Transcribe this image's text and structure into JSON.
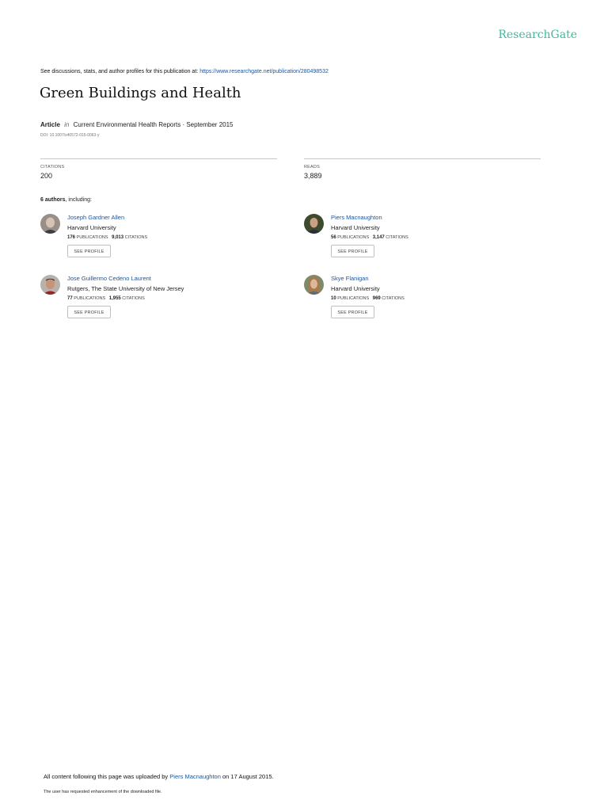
{
  "brand": "ResearchGate",
  "discussion": {
    "prefix": "See discussions, stats, and author profiles for this publication at:",
    "url": "https://www.researchgate.net/publication/280498532"
  },
  "title": "Green Buildings and Health",
  "meta": {
    "type": "Article",
    "in": "in",
    "journal": "Current Environmental Health Reports · September 2015"
  },
  "doi": "DOI: 10.1007/s40572-015-0063-y",
  "stats": {
    "citations": {
      "label": "CITATIONS",
      "value": "200"
    },
    "reads": {
      "label": "READS",
      "value": "3,889"
    }
  },
  "authors_heading": {
    "count": "6 authors",
    "suffix": ", including:"
  },
  "authors": [
    {
      "name": "Joseph Gardner Allen",
      "institution": "Harvard University",
      "publications": "176",
      "publications_label": "PUBLICATIONS",
      "citations": "9,013",
      "citations_label": "CITATIONS",
      "button": "SEE PROFILE"
    },
    {
      "name": "Piers Macnaughton",
      "institution": "Harvard University",
      "publications": "56",
      "publications_label": "PUBLICATIONS",
      "citations": "3,147",
      "citations_label": "CITATIONS",
      "button": "SEE PROFILE"
    },
    {
      "name": "Jose Guillermo Cedeno Laurent",
      "institution": "Rutgers, The State University of New Jersey",
      "publications": "77",
      "publications_label": "PUBLICATIONS",
      "citations": "1,955",
      "citations_label": "CITATIONS",
      "button": "SEE PROFILE"
    },
    {
      "name": "Skye Flanigan",
      "institution": "Harvard University",
      "publications": "10",
      "publications_label": "PUBLICATIONS",
      "citations": "969",
      "citations_label": "CITATIONS",
      "button": "SEE PROFILE"
    }
  ],
  "footer": {
    "upload_prefix": "All content following this page was uploaded by",
    "uploader": "Piers Macnaughton",
    "upload_suffix": "on 17 August 2015.",
    "note": "The user has requested enhancement of the downloaded file."
  },
  "colors": {
    "brand": "#40ba9b",
    "link": "#1a57a3",
    "text": "#222222"
  }
}
